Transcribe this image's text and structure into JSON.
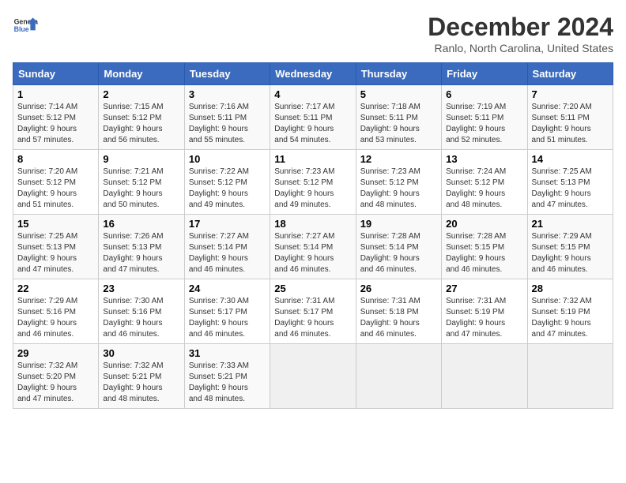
{
  "header": {
    "logo_line1": "General",
    "logo_line2": "Blue",
    "month_title": "December 2024",
    "subtitle": "Ranlo, North Carolina, United States"
  },
  "days_of_week": [
    "Sunday",
    "Monday",
    "Tuesday",
    "Wednesday",
    "Thursday",
    "Friday",
    "Saturday"
  ],
  "weeks": [
    [
      {
        "day": "1",
        "info": "Sunrise: 7:14 AM\nSunset: 5:12 PM\nDaylight: 9 hours\nand 57 minutes."
      },
      {
        "day": "2",
        "info": "Sunrise: 7:15 AM\nSunset: 5:12 PM\nDaylight: 9 hours\nand 56 minutes."
      },
      {
        "day": "3",
        "info": "Sunrise: 7:16 AM\nSunset: 5:11 PM\nDaylight: 9 hours\nand 55 minutes."
      },
      {
        "day": "4",
        "info": "Sunrise: 7:17 AM\nSunset: 5:11 PM\nDaylight: 9 hours\nand 54 minutes."
      },
      {
        "day": "5",
        "info": "Sunrise: 7:18 AM\nSunset: 5:11 PM\nDaylight: 9 hours\nand 53 minutes."
      },
      {
        "day": "6",
        "info": "Sunrise: 7:19 AM\nSunset: 5:11 PM\nDaylight: 9 hours\nand 52 minutes."
      },
      {
        "day": "7",
        "info": "Sunrise: 7:20 AM\nSunset: 5:11 PM\nDaylight: 9 hours\nand 51 minutes."
      }
    ],
    [
      {
        "day": "8",
        "info": "Sunrise: 7:20 AM\nSunset: 5:12 PM\nDaylight: 9 hours\nand 51 minutes."
      },
      {
        "day": "9",
        "info": "Sunrise: 7:21 AM\nSunset: 5:12 PM\nDaylight: 9 hours\nand 50 minutes."
      },
      {
        "day": "10",
        "info": "Sunrise: 7:22 AM\nSunset: 5:12 PM\nDaylight: 9 hours\nand 49 minutes."
      },
      {
        "day": "11",
        "info": "Sunrise: 7:23 AM\nSunset: 5:12 PM\nDaylight: 9 hours\nand 49 minutes."
      },
      {
        "day": "12",
        "info": "Sunrise: 7:23 AM\nSunset: 5:12 PM\nDaylight: 9 hours\nand 48 minutes."
      },
      {
        "day": "13",
        "info": "Sunrise: 7:24 AM\nSunset: 5:12 PM\nDaylight: 9 hours\nand 48 minutes."
      },
      {
        "day": "14",
        "info": "Sunrise: 7:25 AM\nSunset: 5:13 PM\nDaylight: 9 hours\nand 47 minutes."
      }
    ],
    [
      {
        "day": "15",
        "info": "Sunrise: 7:25 AM\nSunset: 5:13 PM\nDaylight: 9 hours\nand 47 minutes."
      },
      {
        "day": "16",
        "info": "Sunrise: 7:26 AM\nSunset: 5:13 PM\nDaylight: 9 hours\nand 47 minutes."
      },
      {
        "day": "17",
        "info": "Sunrise: 7:27 AM\nSunset: 5:14 PM\nDaylight: 9 hours\nand 46 minutes."
      },
      {
        "day": "18",
        "info": "Sunrise: 7:27 AM\nSunset: 5:14 PM\nDaylight: 9 hours\nand 46 minutes."
      },
      {
        "day": "19",
        "info": "Sunrise: 7:28 AM\nSunset: 5:14 PM\nDaylight: 9 hours\nand 46 minutes."
      },
      {
        "day": "20",
        "info": "Sunrise: 7:28 AM\nSunset: 5:15 PM\nDaylight: 9 hours\nand 46 minutes."
      },
      {
        "day": "21",
        "info": "Sunrise: 7:29 AM\nSunset: 5:15 PM\nDaylight: 9 hours\nand 46 minutes."
      }
    ],
    [
      {
        "day": "22",
        "info": "Sunrise: 7:29 AM\nSunset: 5:16 PM\nDaylight: 9 hours\nand 46 minutes."
      },
      {
        "day": "23",
        "info": "Sunrise: 7:30 AM\nSunset: 5:16 PM\nDaylight: 9 hours\nand 46 minutes."
      },
      {
        "day": "24",
        "info": "Sunrise: 7:30 AM\nSunset: 5:17 PM\nDaylight: 9 hours\nand 46 minutes."
      },
      {
        "day": "25",
        "info": "Sunrise: 7:31 AM\nSunset: 5:17 PM\nDaylight: 9 hours\nand 46 minutes."
      },
      {
        "day": "26",
        "info": "Sunrise: 7:31 AM\nSunset: 5:18 PM\nDaylight: 9 hours\nand 46 minutes."
      },
      {
        "day": "27",
        "info": "Sunrise: 7:31 AM\nSunset: 5:19 PM\nDaylight: 9 hours\nand 47 minutes."
      },
      {
        "day": "28",
        "info": "Sunrise: 7:32 AM\nSunset: 5:19 PM\nDaylight: 9 hours\nand 47 minutes."
      }
    ],
    [
      {
        "day": "29",
        "info": "Sunrise: 7:32 AM\nSunset: 5:20 PM\nDaylight: 9 hours\nand 47 minutes."
      },
      {
        "day": "30",
        "info": "Sunrise: 7:32 AM\nSunset: 5:21 PM\nDaylight: 9 hours\nand 48 minutes."
      },
      {
        "day": "31",
        "info": "Sunrise: 7:33 AM\nSunset: 5:21 PM\nDaylight: 9 hours\nand 48 minutes."
      },
      null,
      null,
      null,
      null
    ]
  ]
}
